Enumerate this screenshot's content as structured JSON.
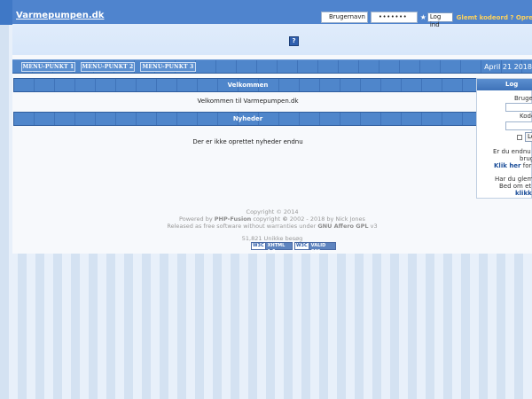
{
  "site": {
    "name": "Varmepumpen.dk"
  },
  "login_top": {
    "username_value": "Brugernavn",
    "password_value": "•••••••",
    "star": "★",
    "login_button": "Log ind",
    "forgot_text": "Glemt kodeord ? Opre"
  },
  "header": {
    "help_icon": "?"
  },
  "nav": {
    "items": [
      {
        "label": "MENU-PUNKT 1"
      },
      {
        "label": "MENU-PUNKT 2"
      },
      {
        "label": "MENU-PUNKT 3"
      }
    ],
    "date": "April 21 2018"
  },
  "welcome": {
    "title": "Velkommen",
    "text": "Velkommen til Varmepumpen.dk"
  },
  "news": {
    "title": "Nyheder",
    "text": "Der er ikke oprettet nyheder endnu"
  },
  "sidebar": {
    "title": "Log",
    "username_label": "Bruge",
    "password_label": "Kode",
    "remember_button": "Lo",
    "register_line1": "Er du endnu ik",
    "register_line2": "brug",
    "register_link": "Klik her",
    "register_line3": " for a",
    "forgot_line1": "Har du glemt",
    "forgot_line2": "Bed om et n",
    "forgot_link": "klikke"
  },
  "footer": {
    "copyright": "Copyright © 2014",
    "powered_pre": "Powered by ",
    "powered_brand": "PHP-Fusion",
    "powered_mid": " copyright ",
    "powered_copy": "©",
    "powered_post": " 2002 - 2018 by Nick Jones",
    "license_pre": "Released as free software without warranties under ",
    "license_name": "GNU Affero GPL",
    "license_post": " v3",
    "visits": "51,821 Unikke besøg",
    "badge_xhtml_w3": "W3C",
    "badge_xhtml_text": "XHTML 1.0",
    "badge_css_w3": "W3C",
    "badge_css_text": "VALID CSS"
  }
}
